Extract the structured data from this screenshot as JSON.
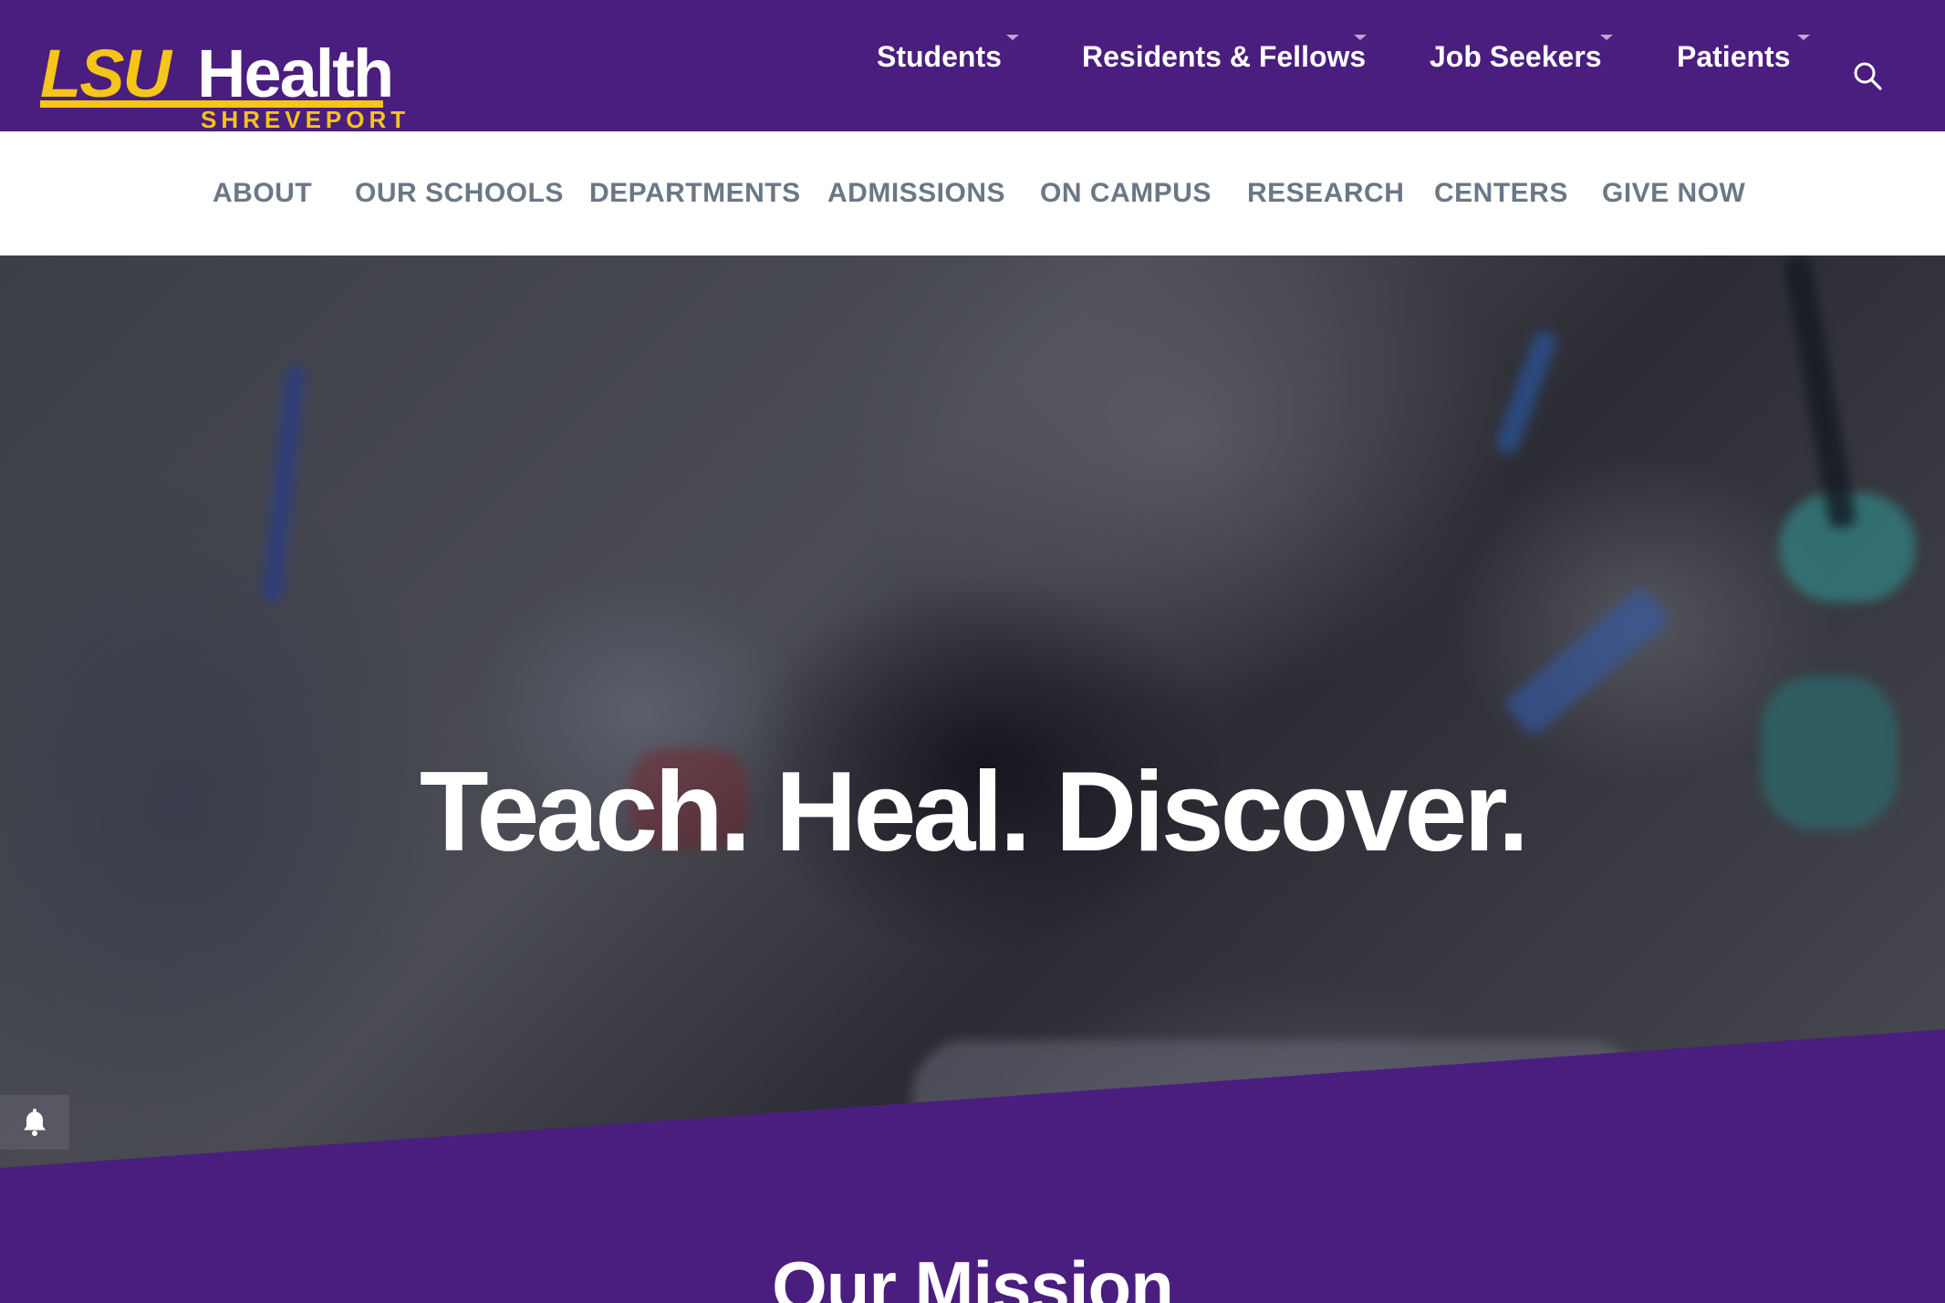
{
  "brand": {
    "logo_primary": "LSU",
    "logo_secondary": "Health",
    "logo_location": "SHREVEPORT",
    "colors": {
      "purple": "#4a1e7e",
      "gold": "#f5c518",
      "nav_text": "#6b7785"
    }
  },
  "audience_nav": [
    {
      "label": "Students",
      "has_dropdown": true
    },
    {
      "label": "Residents & Fellows",
      "has_dropdown": true
    },
    {
      "label": "Job Seekers",
      "has_dropdown": true
    },
    {
      "label": "Patients",
      "has_dropdown": true
    }
  ],
  "search": {
    "icon": "search-icon"
  },
  "main_nav": [
    {
      "label": "ABOUT"
    },
    {
      "label": "OUR SCHOOLS"
    },
    {
      "label": "DEPARTMENTS"
    },
    {
      "label": "ADMISSIONS"
    },
    {
      "label": "ON CAMPUS"
    },
    {
      "label": "RESEARCH"
    },
    {
      "label": "CENTERS"
    },
    {
      "label": "GIVE NOW"
    }
  ],
  "hero": {
    "headline": "Teach. Heal. Discover.",
    "alert_icon": "bell-icon",
    "video_control_icon": "pause-icon"
  },
  "mission": {
    "title": "Our Mission"
  }
}
